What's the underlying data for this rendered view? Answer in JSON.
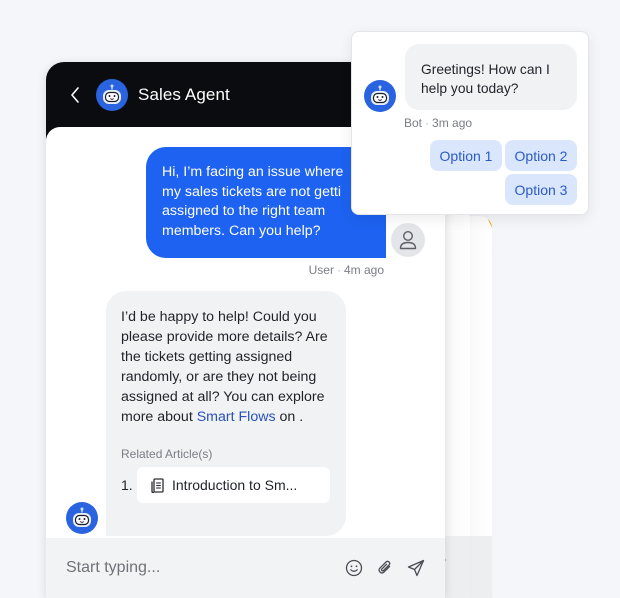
{
  "chat": {
    "title": "Sales Agent",
    "messages": {
      "user": {
        "text": "Hi, I’m facing an issue where\nmy sales tickets are not getti\nassigned to the right team\nmembers. Can you help?",
        "author": "User",
        "time": "4m ago"
      },
      "bot": {
        "text_before_link": "I’d be happy to help! Could you please provide more details? Are the tickets getting assigned randomly, or are they not being assigned at all? You can explore more about ",
        "link_text": "Smart Flows",
        "text_after_link": " on .",
        "related_label": "Related Article(s)",
        "related_articles": [
          {
            "number": "1.",
            "title": "Introduction to Sm..."
          }
        ]
      }
    },
    "composer": {
      "placeholder": "Start typing..."
    }
  },
  "popup": {
    "message": "Greetings! How can I\nhelp you today?",
    "author": "Bot",
    "time": "3m ago",
    "options": [
      "Option 1",
      "Option 2",
      "Option 3"
    ]
  },
  "meta_separator": "·",
  "colors": {
    "header_bg": "#0b0c0f",
    "user_bubble": "#1d62f0",
    "bot_bubble": "#f1f2f4",
    "option_bg": "#d9e6fb",
    "option_text": "#2c5bc7",
    "link": "#2750b8",
    "accent_stack": "#e8b21c"
  }
}
